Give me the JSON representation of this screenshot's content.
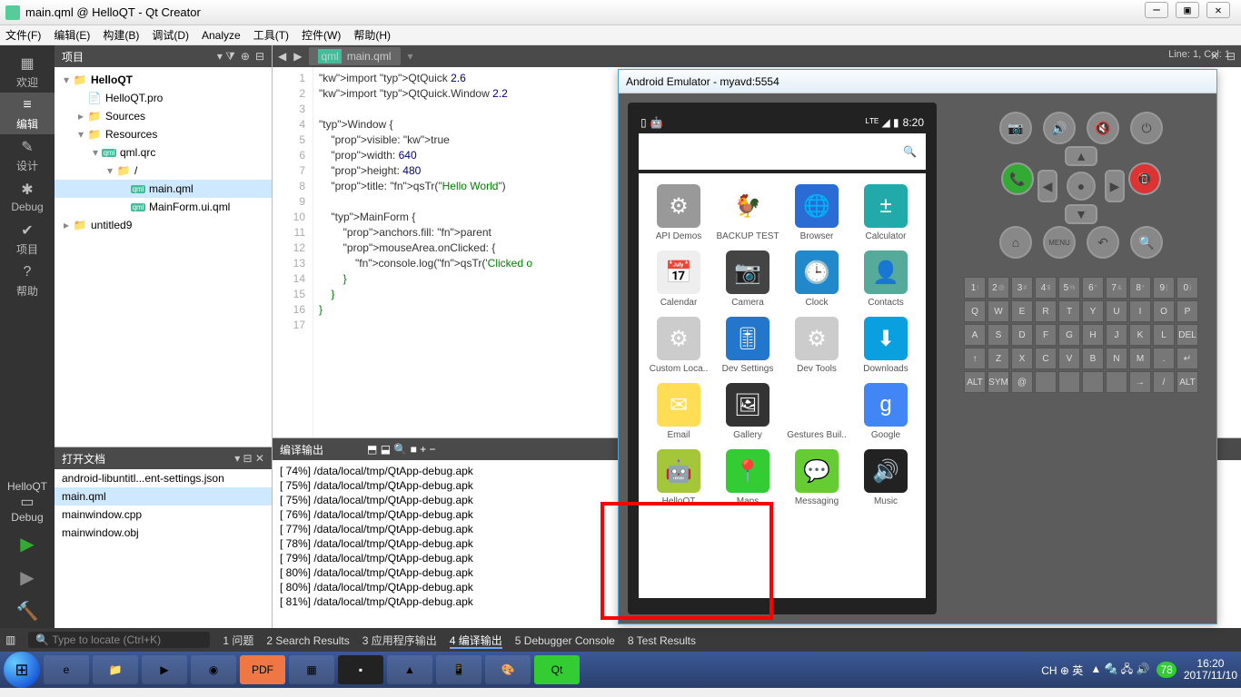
{
  "window": {
    "title": "main.qml @ HelloQT - Qt Creator"
  },
  "menu": [
    "文件(F)",
    "编辑(E)",
    "构建(B)",
    "调试(D)",
    "Analyze",
    "工具(T)",
    "控件(W)",
    "帮助(H)"
  ],
  "lineinfo": "Line: 1, Col: 1",
  "modebar": [
    {
      "label": "欢迎",
      "icon": "▦"
    },
    {
      "label": "编辑",
      "icon": "≡",
      "active": true
    },
    {
      "label": "设计",
      "icon": "✎"
    },
    {
      "label": "Debug",
      "icon": "✱"
    },
    {
      "label": "项目",
      "icon": "✔"
    },
    {
      "label": "帮助",
      "icon": "?"
    }
  ],
  "runTarget": {
    "project": "HelloQT",
    "kit": "Debug"
  },
  "projectPanel": {
    "title": "项目"
  },
  "tree": [
    {
      "ind": 0,
      "tw": "▾",
      "ic": "folder",
      "txt": "HelloQT",
      "bold": true
    },
    {
      "ind": 1,
      "tw": "",
      "ic": "file",
      "txt": "HelloQT.pro"
    },
    {
      "ind": 1,
      "tw": "▸",
      "ic": "folder",
      "txt": "Sources"
    },
    {
      "ind": 1,
      "tw": "▾",
      "ic": "folder",
      "txt": "Resources"
    },
    {
      "ind": 2,
      "tw": "▾",
      "ic": "qml",
      "txt": "qml.qrc"
    },
    {
      "ind": 3,
      "tw": "▾",
      "ic": "folder",
      "txt": "/"
    },
    {
      "ind": 4,
      "tw": "",
      "ic": "qml",
      "txt": "main.qml",
      "sel": true
    },
    {
      "ind": 4,
      "tw": "",
      "ic": "qml",
      "txt": "MainForm.ui.qml"
    },
    {
      "ind": 0,
      "tw": "▸",
      "ic": "folder",
      "txt": "untitled9"
    }
  ],
  "openDocs": {
    "title": "打开文档",
    "items": [
      {
        "txt": "android-libuntitl...ent-settings.json"
      },
      {
        "txt": "main.qml",
        "sel": true
      },
      {
        "txt": "mainwindow.cpp"
      },
      {
        "txt": "mainwindow.obj"
      }
    ]
  },
  "editor": {
    "filename": "main.qml",
    "lines": 17,
    "code": "import QtQuick 2.6\nimport QtQuick.Window 2.2\n\nWindow {\n    visible: true\n    width: 640\n    height: 480\n    title: qsTr(\"Hello World\")\n\n    MainForm {\n        anchors.fill: parent\n        mouseArea.onClicked: {\n            console.log(qsTr('Clicked o\n        }\n    }\n}\n"
  },
  "compile": {
    "title": "编译输出",
    "lines": [
      "[ 74%] /data/local/tmp/QtApp-debug.apk",
      "[ 75%] /data/local/tmp/QtApp-debug.apk",
      "[ 75%] /data/local/tmp/QtApp-debug.apk",
      "[ 76%] /data/local/tmp/QtApp-debug.apk",
      "[ 77%] /data/local/tmp/QtApp-debug.apk",
      "[ 78%] /data/local/tmp/QtApp-debug.apk",
      "[ 79%] /data/local/tmp/QtApp-debug.apk",
      "[ 80%] /data/local/tmp/QtApp-debug.apk",
      "[ 80%] /data/local/tmp/QtApp-debug.apk",
      "[ 81%] /data/local/tmp/QtApp-debug.apk"
    ]
  },
  "status": {
    "loc": "Type to locate (Ctrl+K)",
    "tabs": [
      "1 问题",
      "2 Search Results",
      "3 应用程序输出",
      "4 编译输出",
      "5 Debugger Console",
      "8 Test Results"
    ],
    "active": 3
  },
  "emulator": {
    "title": "Android Emulator - myavd:5554",
    "time": "8:20",
    "apps": [
      {
        "n": "API Demos",
        "c": "#999",
        "i": "⚙"
      },
      {
        "n": "BACKUP TEST",
        "c": "#fff",
        "i": "🐓"
      },
      {
        "n": "Browser",
        "c": "#2a6bd4",
        "i": "🌐"
      },
      {
        "n": "Calculator",
        "c": "#2aa",
        "i": "±"
      },
      {
        "n": "Calendar",
        "c": "#eee",
        "i": "📅"
      },
      {
        "n": "Camera",
        "c": "#444",
        "i": "📷"
      },
      {
        "n": "Clock",
        "c": "#28c",
        "i": "🕒"
      },
      {
        "n": "Contacts",
        "c": "#5a9",
        "i": "👤"
      },
      {
        "n": "Custom Loca..",
        "c": "#ccc",
        "i": "⚙"
      },
      {
        "n": "Dev Settings",
        "c": "#27c",
        "i": "🎚"
      },
      {
        "n": "Dev Tools",
        "c": "#ccc",
        "i": "⚙"
      },
      {
        "n": "Downloads",
        "c": "#0aa0e0",
        "i": "⬇"
      },
      {
        "n": "Email",
        "c": "#fd5",
        "i": "✉"
      },
      {
        "n": "Gallery",
        "c": "#333",
        "i": "🖼"
      },
      {
        "n": "Gestures Buil..",
        "c": "#fff",
        "i": "〰"
      },
      {
        "n": "Google",
        "c": "#4285f4",
        "i": "g"
      },
      {
        "n": "HelloQT",
        "c": "#a4c639",
        "i": "🤖"
      },
      {
        "n": "Maps",
        "c": "#3c3",
        "i": "📍"
      },
      {
        "n": "Messaging",
        "c": "#6c3",
        "i": "💬"
      },
      {
        "n": "Music",
        "c": "#222",
        "i": "🔊"
      }
    ],
    "ctrlTop": [
      "📷",
      "🔊",
      "🔇",
      "⏻"
    ],
    "ctrlMid": [
      "📞",
      "📵"
    ],
    "ctrlBot": [
      "⌂",
      "MENU",
      "↶",
      "🔍"
    ],
    "kbd": [
      [
        "1!",
        "2@",
        "3#",
        "4$",
        "5%",
        "6^",
        "7&",
        "8*",
        "9(",
        "0)"
      ],
      [
        "Q",
        "W",
        "E",
        "R",
        "T",
        "Y",
        "U",
        "I",
        "O",
        "P"
      ],
      [
        "A",
        "S",
        "D",
        "F",
        "G",
        "H",
        "J",
        "K",
        "L",
        "DEL"
      ],
      [
        "↑",
        "Z",
        "X",
        "C",
        "V",
        "B",
        "N",
        "M",
        ".",
        "↵"
      ],
      [
        "ALT",
        "SYM",
        "@",
        "",
        "",
        "",
        "",
        "→",
        "/",
        "ALT"
      ]
    ]
  },
  "tray": {
    "ime": "CH ⊕ 英",
    "time": "16:20",
    "date": "2017/11/10",
    "battery": "78"
  }
}
